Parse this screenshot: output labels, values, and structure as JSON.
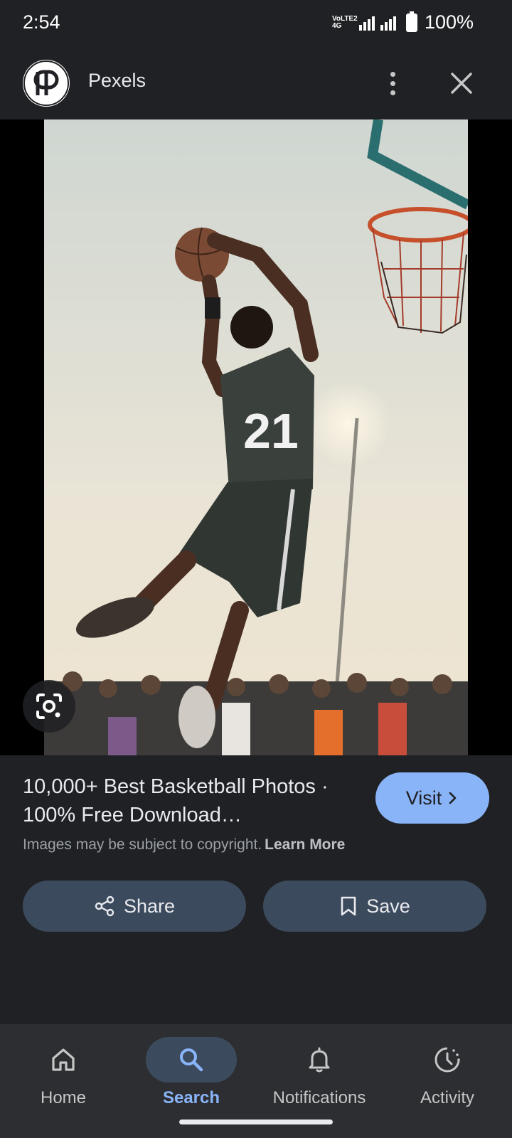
{
  "status_bar": {
    "time": "2:54",
    "network_label": "VoLTE2 4G",
    "battery": "100%"
  },
  "header": {
    "site_name": "Pexels",
    "logo_icon": "pexels-logo-icon",
    "more_icon": "more-vert-icon",
    "close_icon": "close-icon"
  },
  "image": {
    "description_icon": "lens-icon",
    "jersey_number": "21"
  },
  "result": {
    "title": "10,000+ Best Basketball Photos · 100% Free Download…",
    "visit_label": "Visit",
    "copyright_text": "Images may be subject to copyright.",
    "learn_more": "Learn More"
  },
  "actions": {
    "share_label": "Share",
    "save_label": "Save"
  },
  "bottom_nav": {
    "items": [
      {
        "label": "Home",
        "icon": "home-icon"
      },
      {
        "label": "Search",
        "icon": "search-icon"
      },
      {
        "label": "Notifications",
        "icon": "bell-icon"
      },
      {
        "label": "Activity",
        "icon": "activity-icon"
      }
    ],
    "active": "Search"
  },
  "colors": {
    "background": "#202124",
    "accent": "#8ab4f8",
    "button": "#3c4a5e",
    "nav_background": "#2d2e31"
  }
}
